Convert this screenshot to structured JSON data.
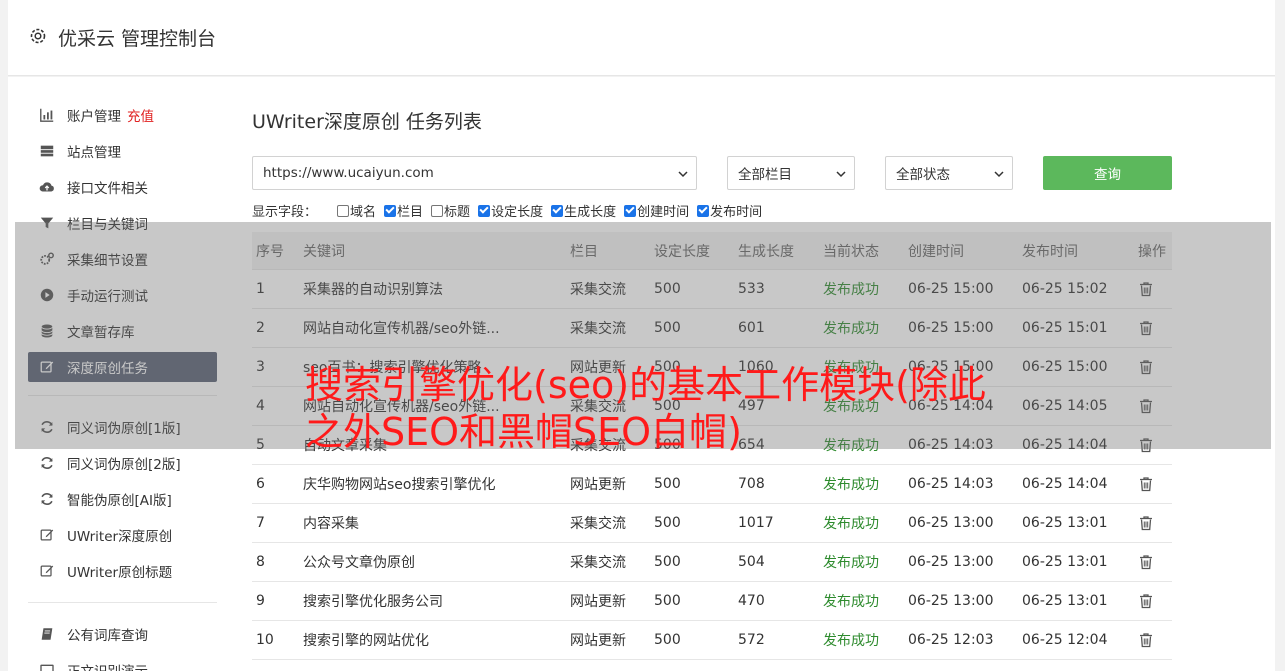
{
  "app": {
    "title": "优采云 管理控制台"
  },
  "sidebar": {
    "group1": [
      {
        "label": "账户管理",
        "extra": "充值",
        "icon": "bar-chart-icon"
      },
      {
        "label": "站点管理",
        "icon": "server-icon"
      },
      {
        "label": "接口文件相关",
        "icon": "cloud-upload-icon"
      },
      {
        "label": "栏目与关键词",
        "icon": "filter-icon"
      },
      {
        "label": "采集细节设置",
        "icon": "gears-icon"
      },
      {
        "label": "手动运行测试",
        "icon": "play-circle-icon"
      },
      {
        "label": "文章暂存库",
        "icon": "database-icon"
      },
      {
        "label": "深度原创任务",
        "icon": "edit-icon",
        "active": true
      }
    ],
    "group2": [
      {
        "label": "同义词伪原创[1版]",
        "icon": "refresh-icon"
      },
      {
        "label": "同义词伪原创[2版]",
        "icon": "refresh-icon"
      },
      {
        "label": "智能伪原创[AI版]",
        "icon": "refresh-icon"
      },
      {
        "label": "UWriter深度原创",
        "icon": "edit-icon"
      },
      {
        "label": "UWriter原创标题",
        "icon": "edit-icon"
      }
    ],
    "group3": [
      {
        "label": "公有词库查询",
        "icon": "book-icon"
      },
      {
        "label": "正文识别演示",
        "icon": "monitor-icon"
      }
    ]
  },
  "page": {
    "title": "UWriter深度原创 任务列表",
    "site_select": "https://www.ucaiyun.com",
    "column_select": "全部栏目",
    "status_select": "全部状态",
    "query_button": "查询",
    "fields_label": "显示字段：",
    "fields": [
      {
        "label": "域名",
        "checked": false
      },
      {
        "label": "栏目",
        "checked": true
      },
      {
        "label": "标题",
        "checked": false
      },
      {
        "label": "设定长度",
        "checked": true
      },
      {
        "label": "生成长度",
        "checked": true
      },
      {
        "label": "创建时间",
        "checked": true
      },
      {
        "label": "发布时间",
        "checked": true
      }
    ]
  },
  "table": {
    "headers": [
      "序号",
      "关键词",
      "栏目",
      "设定长度",
      "生成长度",
      "当前状态",
      "创建时间",
      "发布时间",
      "操作"
    ],
    "rows": [
      [
        "1",
        "采集器的自动识别算法",
        "采集交流",
        "500",
        "533",
        "发布成功",
        "06-25 15:00",
        "06-25 15:02"
      ],
      [
        "2",
        "网站自动化宣传机器/seo外链...",
        "采集交流",
        "500",
        "601",
        "发布成功",
        "06-25 15:00",
        "06-25 15:01"
      ],
      [
        "3",
        "seo百书：搜索引擎优化策略",
        "网站更新",
        "500",
        "1060",
        "发布成功",
        "06-25 15:00",
        "06-25 15:00"
      ],
      [
        "4",
        "网站自动化宣传机器/seo外链...",
        "采集交流",
        "500",
        "497",
        "发布成功",
        "06-25 14:04",
        "06-25 14:05"
      ],
      [
        "5",
        "自动文章采集",
        "采集交流",
        "500",
        "654",
        "发布成功",
        "06-25 14:03",
        "06-25 14:04"
      ],
      [
        "6",
        "庆华购物网站seo搜索引擎优化",
        "网站更新",
        "500",
        "708",
        "发布成功",
        "06-25 14:03",
        "06-25 14:04"
      ],
      [
        "7",
        "内容采集",
        "采集交流",
        "500",
        "1017",
        "发布成功",
        "06-25 13:00",
        "06-25 13:01"
      ],
      [
        "8",
        "公众号文章伪原创",
        "采集交流",
        "500",
        "504",
        "发布成功",
        "06-25 13:00",
        "06-25 13:01"
      ],
      [
        "9",
        "搜索引擎优化服务公司",
        "网站更新",
        "500",
        "470",
        "发布成功",
        "06-25 13:00",
        "06-25 13:01"
      ],
      [
        "10",
        "搜索引擎的网站优化",
        "网站更新",
        "500",
        "572",
        "发布成功",
        "06-25 12:03",
        "06-25 12:04"
      ]
    ]
  },
  "overlay": {
    "headline": "搜索引擎优化(seo)的基本工作模块(除此之外SEO和黑帽SEO白帽)",
    "color": "#ff1a1a"
  }
}
